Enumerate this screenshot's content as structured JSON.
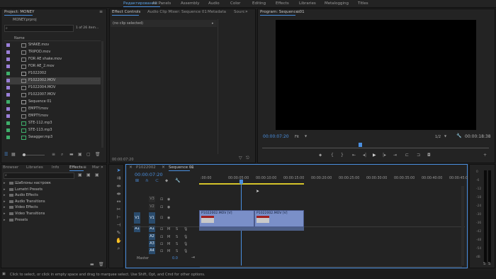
{
  "workspaces": [
    {
      "label": "Редактирование",
      "active": true
    },
    {
      "label": "All Panels",
      "active": false
    },
    {
      "label": "Assembly",
      "active": false
    },
    {
      "label": "Audio",
      "active": false
    },
    {
      "label": "Color",
      "active": false
    },
    {
      "label": "Editing",
      "active": false
    },
    {
      "label": "Effects",
      "active": false
    },
    {
      "label": "Libraries",
      "active": false
    },
    {
      "label": "Metalogging",
      "active": false
    },
    {
      "label": "Titles",
      "active": false
    }
  ],
  "project": {
    "title": "Project: MONEY",
    "file": "MONEY.prproj",
    "item_count": "1 of 26 item...",
    "name_header": "Name",
    "items": [
      {
        "name": "SHAKE.mov",
        "color": "#9a7fd8",
        "type": "video"
      },
      {
        "name": "TRIPOD.mov",
        "color": "#9a7fd8",
        "type": "video"
      },
      {
        "name": "FOR AE shake.mov",
        "color": "#9a7fd8",
        "type": "video"
      },
      {
        "name": "FOR AE_2.mov",
        "color": "#9a7fd8",
        "type": "video"
      },
      {
        "name": "P1022002",
        "color": "#3fae6b",
        "type": "sequence"
      },
      {
        "name": "P1022002.MOV",
        "color": "#9a7fd8",
        "type": "video",
        "selected": true
      },
      {
        "name": "P1022004.MOV",
        "color": "#9a7fd8",
        "type": "video"
      },
      {
        "name": "P1022007.MOV",
        "color": "#9a7fd8",
        "type": "video"
      },
      {
        "name": "Sequence 01",
        "color": "#3fae6b",
        "type": "sequence"
      },
      {
        "name": "EMPTY.mov",
        "color": "#9a7fd8",
        "type": "video"
      },
      {
        "name": "EMPTY.mov",
        "color": "#9a7fd8",
        "type": "video"
      },
      {
        "name": "STE-112.mp3",
        "color": "#3fae6b",
        "type": "audio"
      },
      {
        "name": "STE-113.mp3",
        "color": "#3fae6b",
        "type": "audio"
      },
      {
        "name": "Swagger.mp3",
        "color": "#3fae6b",
        "type": "audio"
      }
    ]
  },
  "source_tabs": [
    {
      "label": "Effect Controls",
      "active": true
    },
    {
      "label": "Audio Clip Mixer: Sequence 01",
      "active": false
    },
    {
      "label": "Metadata",
      "active": false
    },
    {
      "label": "Sourc",
      "active": false
    }
  ],
  "effect_controls": {
    "no_clip": "(no clip selected)",
    "timecode": "00:00:07:20"
  },
  "program": {
    "title": "Program: Sequence 01",
    "timecode": "00:00:07:20",
    "fit": "Fit",
    "resolution": "1/2",
    "duration": "00:00:18:38",
    "playhead_fraction": 0.43
  },
  "effects_panel": {
    "tabs": [
      {
        "label": "Browser",
        "active": false
      },
      {
        "label": "Libraries",
        "active": false
      },
      {
        "label": "Info",
        "active": false
      },
      {
        "label": "Effects",
        "active": true
      },
      {
        "label": "Mar",
        "active": false
      }
    ],
    "items": [
      "Шаблоны настроек",
      "Lumetri Presets",
      "Audio Effects",
      "Audio Transitions",
      "Video Effects",
      "Video Transitions",
      "Presets"
    ]
  },
  "timeline": {
    "tabs": [
      {
        "label": "P1022002",
        "active": false
      },
      {
        "label": "Sequence 01",
        "active": true
      }
    ],
    "timecode": "00:00:07:20",
    "ticks": [
      ":00:00",
      "00:00:05:00",
      "00:00:10:00",
      "00:00:15:00",
      "00:00:20:00",
      "00:00:25:00",
      "00:00:30:00",
      "00:00:35:00",
      "00:00:40:00",
      "00:00:45:0"
    ],
    "video_tracks": [
      "V3",
      "V2",
      "V1"
    ],
    "audio_tracks": [
      "A1",
      "A2",
      "A3",
      "A4"
    ],
    "source_patch_v": "V1",
    "source_patch_a": "A1",
    "master_value": "0.0",
    "clips": [
      "P1022002.MOV [V]",
      "P1022002.MOV [V]"
    ]
  },
  "meter_labels": [
    "0",
    "-6",
    "-12",
    "-18",
    "-24",
    "-30",
    "-36",
    "-42",
    "-48",
    "-54",
    "dB"
  ],
  "status_bar": "Click to select, or click in empty space and drag to marquee select. Use Shift, Opt, and Cmd for other options."
}
